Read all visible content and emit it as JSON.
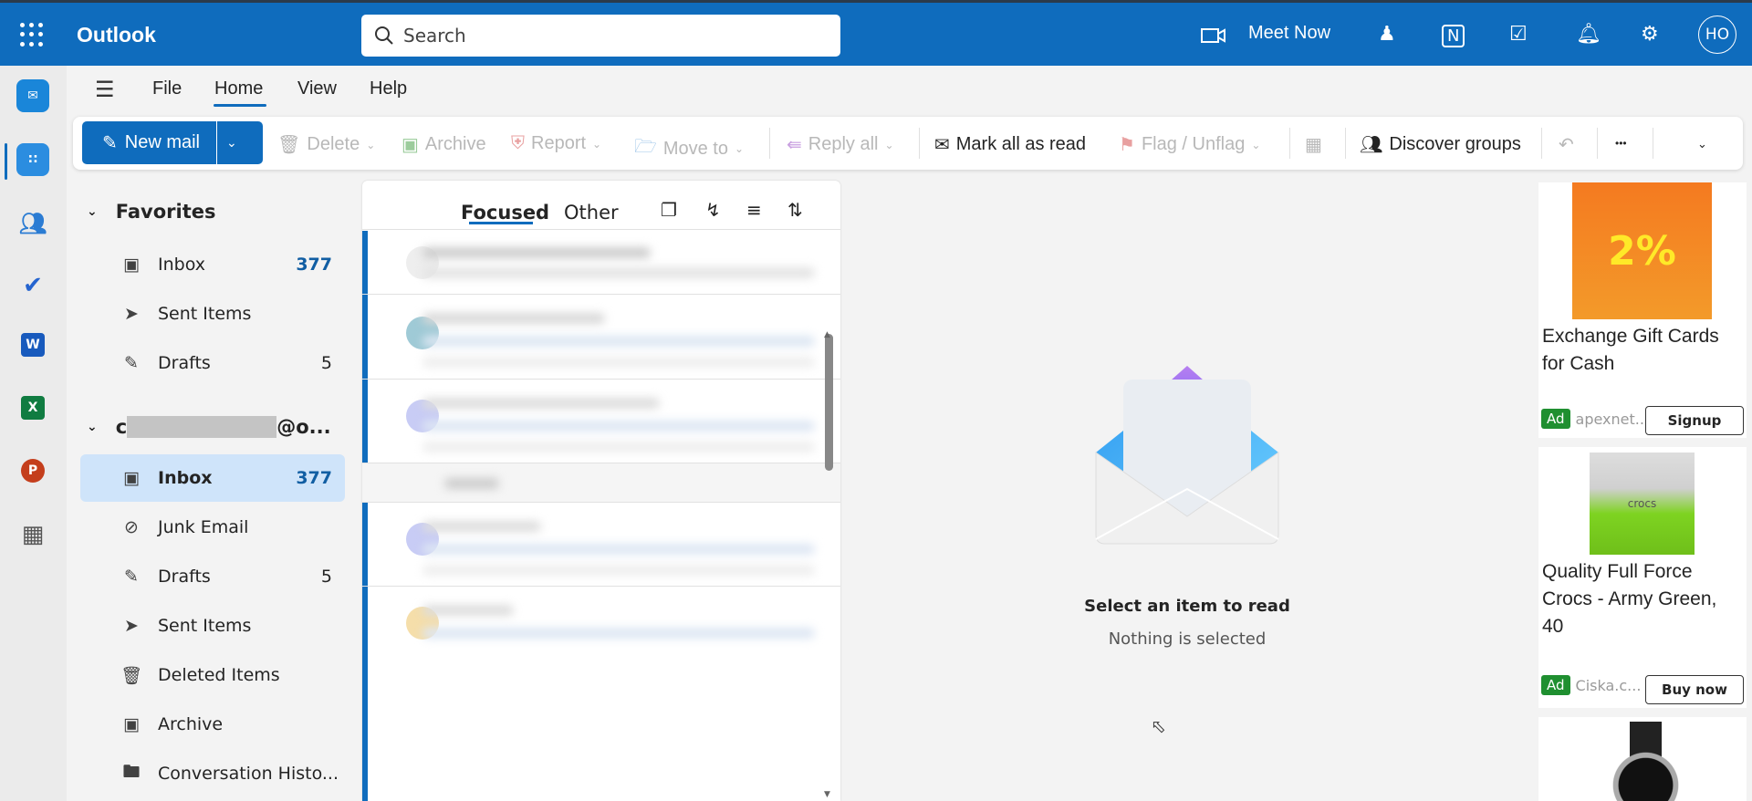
{
  "app": {
    "title": "Outlook"
  },
  "search": {
    "placeholder": "Search"
  },
  "header": {
    "meet_now": "Meet Now",
    "avatar_initials": "HO"
  },
  "menu": {
    "tabs": [
      "File",
      "Home",
      "View",
      "Help"
    ],
    "active": "Home"
  },
  "toolbar": {
    "new_mail": "New mail",
    "delete": "Delete",
    "archive": "Archive",
    "report": "Report",
    "move_to": "Move to",
    "reply_all": "Reply all",
    "mark_all_read": "Mark all as read",
    "flag": "Flag / Unflag",
    "discover_groups": "Discover groups",
    "more": "•••"
  },
  "folders": {
    "favorites_label": "Favorites",
    "favorites": [
      {
        "label": "Inbox",
        "count": "377"
      },
      {
        "label": "Sent Items",
        "count": ""
      },
      {
        "label": "Drafts",
        "count": "5"
      }
    ],
    "account_label_start": "c",
    "account_label_end": "@o...",
    "account": [
      {
        "label": "Inbox",
        "count": "377"
      },
      {
        "label": "Junk Email",
        "count": ""
      },
      {
        "label": "Drafts",
        "count": "5"
      },
      {
        "label": "Sent Items",
        "count": ""
      },
      {
        "label": "Deleted Items",
        "count": ""
      },
      {
        "label": "Archive",
        "count": ""
      },
      {
        "label": "Conversation Histo...",
        "count": ""
      }
    ]
  },
  "list": {
    "tabs": [
      "Focused",
      "Other"
    ],
    "active": "Focused"
  },
  "reading": {
    "title": "Select an item to read",
    "subtitle": "Nothing is selected"
  },
  "ads": [
    {
      "title": "Exchange Gift Cards for Cash",
      "badge": "Ad",
      "source": "apexnet...",
      "button": "Signup",
      "image_text": "2%"
    },
    {
      "title": "Quality Full Force Crocs - Army Green, 40",
      "badge": "Ad",
      "source": "Ciska.c...",
      "button": "Buy now",
      "image_text": "crocs"
    }
  ],
  "colors": {
    "brand": "#0f6cbd",
    "ad_badge": "#1f8f30",
    "selected_folder": "#cfe4fa"
  }
}
